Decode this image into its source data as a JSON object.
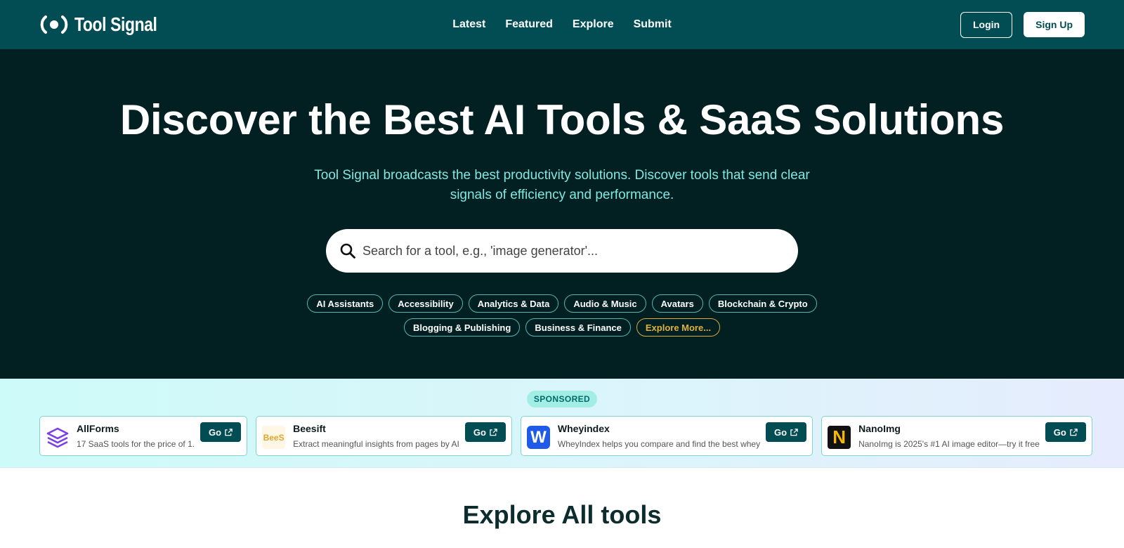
{
  "nav": {
    "brand": "Tool Signal",
    "links": [
      "Latest",
      "Featured",
      "Explore",
      "Submit"
    ],
    "login": "Login",
    "signup": "Sign Up"
  },
  "hero": {
    "title": "Discover the Best AI Tools & SaaS Solutions",
    "subtitle": "Tool Signal broadcasts the best productivity solutions. Discover tools that send clear signals of efficiency and performance.",
    "search_placeholder": "Search for a tool, e.g., 'image generator'...",
    "tags": [
      "AI Assistants",
      "Accessibility",
      "Analytics & Data",
      "Audio & Music",
      "Avatars",
      "Blockchain & Crypto",
      "Blogging & Publishing",
      "Business & Finance"
    ],
    "more_tag": "Explore More..."
  },
  "sponsored": {
    "badge": "SPONSORED",
    "go_label": "Go",
    "cards": [
      {
        "name": "AllForms",
        "desc": "17 SaaS tools for the price of 1.",
        "icon": "layers-icon",
        "color": "#7b3fe4"
      },
      {
        "name": "Beesift",
        "desc": "Extract meaningful insights from pages by AI",
        "logo_text": "BeeS",
        "icon": "beesift-logo",
        "color": "#e0a52a"
      },
      {
        "name": "Wheyindex",
        "desc": "WheyIndex helps you compare and find the best whey",
        "logo_text": "W",
        "icon": "wheyindex-logo",
        "color": "#1f5be8"
      },
      {
        "name": "NanoImg",
        "desc": "NanoImg is 2025's #1 AI image editor—try it free",
        "logo_text": "N",
        "icon": "nanoimg-logo",
        "color": "#f5b800"
      }
    ]
  },
  "explore": {
    "title": "Explore All tools"
  }
}
